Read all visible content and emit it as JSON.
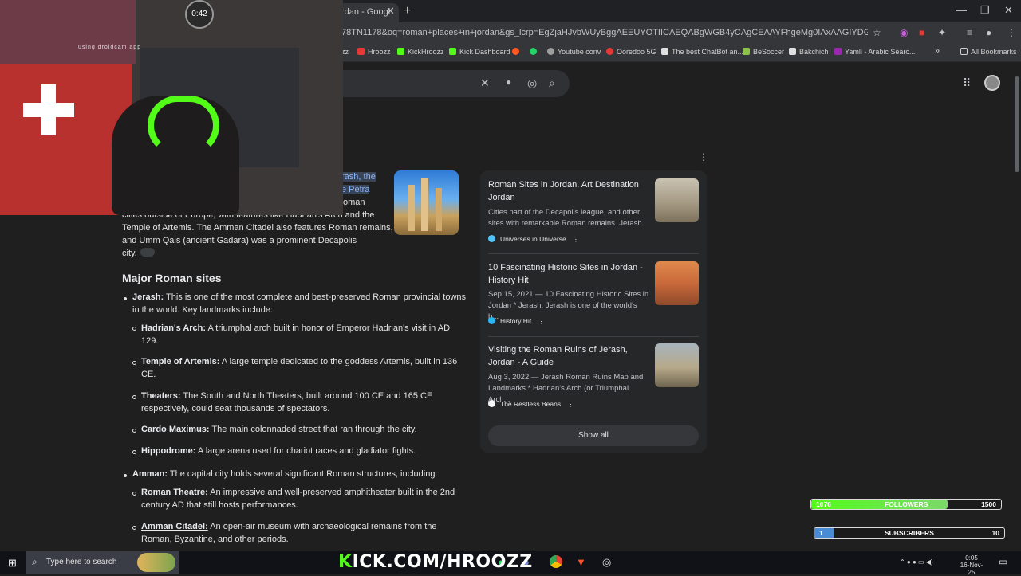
{
  "browser": {
    "tab_title": "rdan - Googl",
    "tab_close": "✕",
    "new_tab": "+",
    "url": "78TN1178&oq=roman+places+in+jordan&gs_lcrp=EgZjaHJvbWUyBggAEEUYOTIICAEQABgWGB4yCAgCEAAYFhgeMg0IAxAAGIYDGIAEGIoFMgoIBBAAGIAEGK...",
    "window_controls": [
      "—",
      "❐",
      "✕"
    ],
    "bookmarks": [
      {
        "label": "zz",
        "color": "#888888"
      },
      {
        "label": "Hroozz",
        "color": "#e53935"
      },
      {
        "label": "KickHroozz",
        "color": "#53fc18"
      },
      {
        "label": "Kick Dashboard",
        "color": "#53fc18"
      },
      {
        "label": "",
        "color": "#ff5722"
      },
      {
        "label": "",
        "color": "#25d366"
      },
      {
        "label": "Youtube conv",
        "color": "#9e9e9e"
      },
      {
        "label": "Ooredoo 5G",
        "color": "#e53935"
      },
      {
        "label": "The best ChatBot an...",
        "color": "#e0e0e0"
      },
      {
        "label": "BeSoccer",
        "color": "#8bc34a"
      },
      {
        "label": "Bakchich",
        "color": "#e0e0e0"
      },
      {
        "label": "Yamli - Arabic Searc...",
        "color": "#9c27b0"
      }
    ],
    "bookmarks_overflow": "»",
    "all_bookmarks": "All Bookmarks"
  },
  "search": {
    "clear": "✕",
    "mic": "🎤",
    "lens": "◎",
    "search": "🔍",
    "apps": "⋮⋮⋮",
    "more": "⋮"
  },
  "article": {
    "intro_line1_tail": "rash",
    "intro_line1_tail2": ", the",
    "intro_line2_tail": "e Petra",
    "intro_line3_tail": "oman",
    "intro_line4": "cities outside of Europe, with features like Hadrian's Arch and the",
    "intro_line5": "Temple of Artemis. The Amman Citadel also features Roman remains,",
    "intro_line6": "and Umm Qais (ancient Gadara) was a prominent Decapolis",
    "intro_line7": "city.",
    "heading": "Major Roman sites",
    "jerash_label": "Jerash:",
    "jerash_text1": " This is one of the most complete and best-preserved Roman provincial towns",
    "jerash_text2": "in the world. Key landmarks include:",
    "hadrian_label": "Hadrian's Arch:",
    "hadrian_text1": " A triumphal arch built in honor of Emperor Hadrian's visit in AD",
    "hadrian_text2": "129.",
    "artemis_label": "Temple of Artemis:",
    "artemis_text1": " A large temple dedicated to the goddess Artemis, built in 136",
    "artemis_text2": "CE.",
    "theaters_label": "Theaters:",
    "theaters_text1": " The South and North Theaters, built around 100 CE and 165 CE",
    "theaters_text2": "respectively, could seat thousands of spectators.",
    "cardo_label": "Cardo Maximus:",
    "cardo_text": " The main colonnaded street that ran through the city.",
    "hippo_label": "Hippodrome:",
    "hippo_text": " A large arena used for chariot races and gladiator fights.",
    "amman_label": "Amman:",
    "amman_text": " The capital city holds several significant Roman structures, including:",
    "theatre_label": "Roman Theatre:",
    "theatre_text1": " An impressive and well-preserved amphitheater built in the 2nd",
    "theatre_text2": "century AD that still hosts performances.",
    "citadel_label": "Amman Citadel:",
    "citadel_text1": " An open-air museum with archaeological remains from the",
    "citadel_text2": "Roman, Byzantine, and other periods."
  },
  "sources": [
    {
      "title": "Roman Sites in Jordan. Art Destination Jordan",
      "snippet": "Cities part of the Decapolis league, and other sites with remarkable Roman remains. Jerash ...",
      "site": "Universes in Universe",
      "fav_color": "#4fc3f7"
    },
    {
      "title": "10 Fascinating Historic Sites in Jordan - History Hit",
      "snippet": "Sep 15, 2021 — 10 Fascinating Historic Sites in Jordan * Jerash. Jerash is one of the world's b...",
      "site": "History Hit",
      "fav_color": "#29b6f6"
    },
    {
      "title": "Visiting the Roman Ruins of Jerash, Jordan - A Guide",
      "snippet": "Aug 3, 2022 — Jerash Roman Ruins Map and Landmarks * Hadrian's Arch (or Triumphal Arch...",
      "site": "The Restless Beans",
      "fav_color": "#f5f5f5"
    }
  ],
  "show_all": "Show all",
  "overlay": {
    "followers": {
      "current": "1076",
      "label": "FOLLOWERS",
      "goal": "1500",
      "progress": 0.72
    },
    "subscribers": {
      "current": "1",
      "label": "SUBSCRIBERS",
      "goal": "10",
      "progress": 0.1
    },
    "kick_prefix": "K",
    "kick_rest": "ICK.COM/HROOZZ",
    "webcam_watermark": "using droidcam app",
    "clock": "0:42"
  },
  "taskbar": {
    "search_placeholder": "Type here to search",
    "time": "0:05",
    "date": "16-Nov-25"
  }
}
